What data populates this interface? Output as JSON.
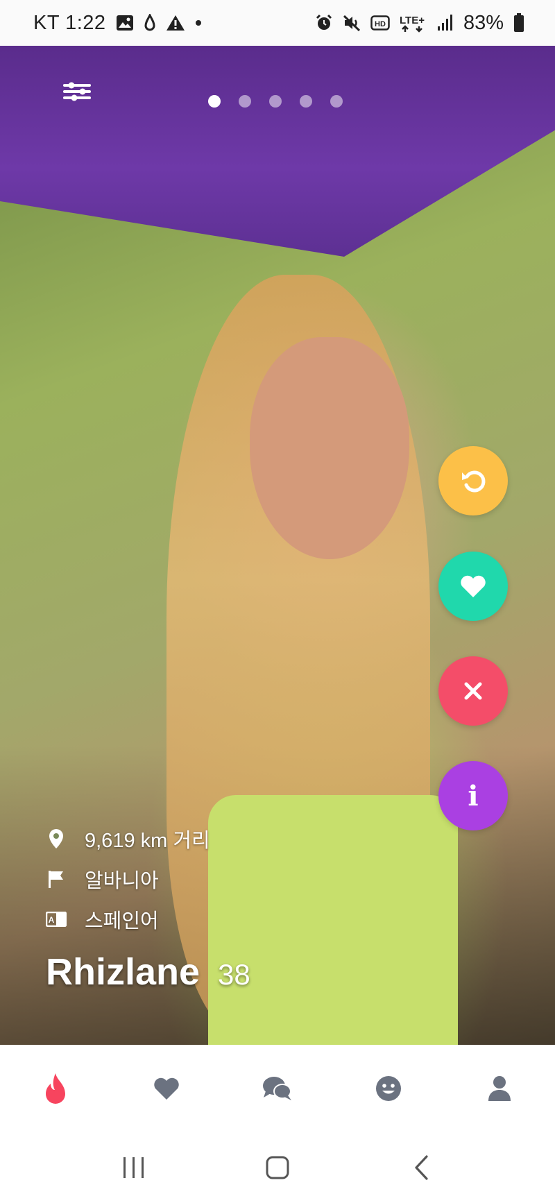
{
  "status_bar": {
    "carrier_time": "KT 1:22",
    "network": "LTE+",
    "battery_percent": "83%",
    "icons_left": [
      "image-icon",
      "drop-icon",
      "warning-icon",
      "dot-icon"
    ],
    "icons_right": [
      "alarm-icon",
      "mute-icon",
      "hd-icon",
      "lte-icon",
      "signal-icon",
      "battery-icon"
    ]
  },
  "profile": {
    "photo_page": {
      "current": 1,
      "total": 5
    },
    "distance": "9,619 km 거리",
    "country": "알바니아",
    "language": "스페인어",
    "name": "Rhizlane",
    "age": "38"
  },
  "actions": {
    "rewind": {
      "icon": "rewind-icon",
      "color": "#fcc048"
    },
    "like": {
      "icon": "heart-icon",
      "color": "#20d8ac"
    },
    "nope": {
      "icon": "close-icon",
      "color": "#f44d69"
    },
    "info": {
      "icon": "info-icon",
      "label": "i",
      "color": "#aa40e2"
    }
  },
  "tabs": [
    {
      "name": "discover",
      "icon": "flame-icon",
      "active": true,
      "color": "#f7445e"
    },
    {
      "name": "likes",
      "icon": "heart-icon",
      "active": false,
      "color": "#6b7280"
    },
    {
      "name": "chats",
      "icon": "chat-bubbles-icon",
      "active": false,
      "color": "#6b7280"
    },
    {
      "name": "moments",
      "icon": "smiley-icon",
      "active": false,
      "color": "#6b7280"
    },
    {
      "name": "profile",
      "icon": "person-icon",
      "active": false,
      "color": "#6b7280"
    }
  ],
  "system_nav": [
    "recent-apps-icon",
    "home-icon",
    "back-icon"
  ]
}
